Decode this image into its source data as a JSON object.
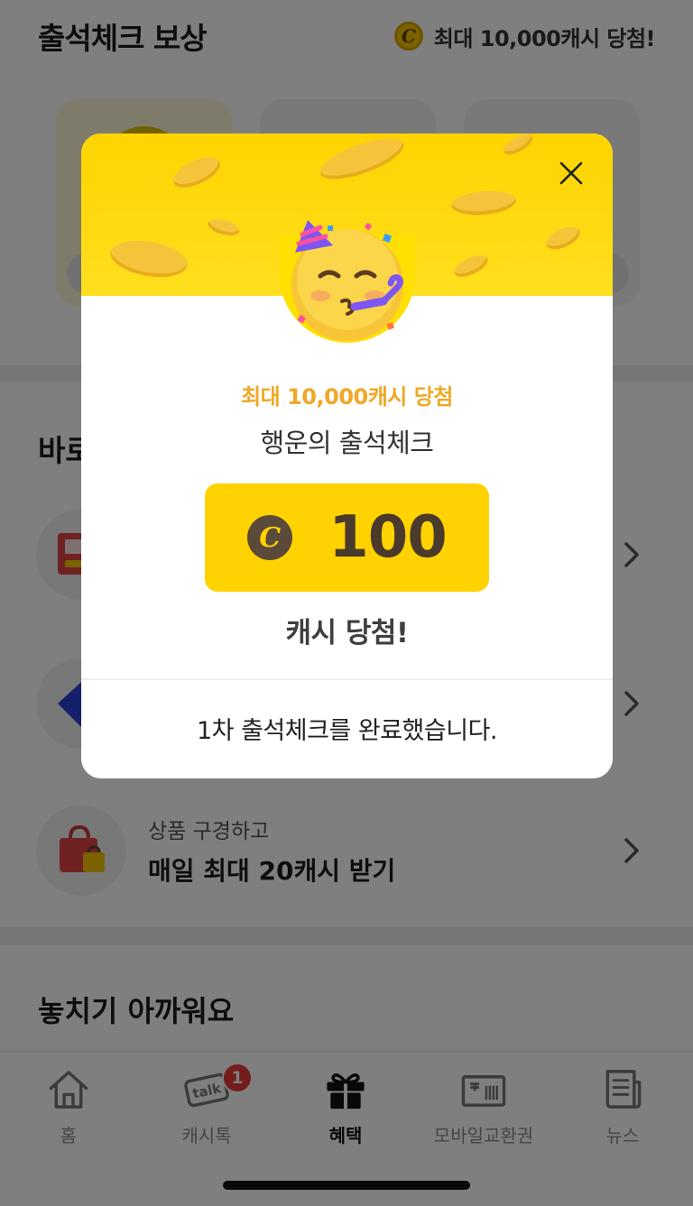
{
  "header": {
    "title": "출석체크 보상",
    "promo_text": "최대 10,000캐시 당첨!",
    "coin_symbol": "C"
  },
  "sections": {
    "shortcuts_title": "바로",
    "missed_title": "놓치기 아까워요"
  },
  "shortcuts": [
    {
      "icon": "receipt-icon",
      "sub": "",
      "main": ""
    },
    {
      "icon": "diamond-icon",
      "sub": "",
      "main": ""
    },
    {
      "icon": "shopping-bag-icon",
      "sub": "상품 구경하고",
      "main": "매일 최대 20캐시 받기"
    }
  ],
  "tabbar": {
    "items": [
      {
        "label": "홈",
        "icon": "home-icon"
      },
      {
        "label": "캐시톡",
        "icon": "talk-icon",
        "badge": "1"
      },
      {
        "label": "혜택",
        "icon": "gift-icon",
        "active": true
      },
      {
        "label": "모바일교환권",
        "icon": "ticket-icon"
      },
      {
        "label": "뉴스",
        "icon": "news-icon"
      }
    ]
  },
  "modal": {
    "promo": "최대 10,000캐시 당첨",
    "subtitle": "행운의 출석체크",
    "coin_symbol": "C",
    "amount": "100",
    "result": "캐시 당첨!",
    "footer": "1차 출석체크를 완료했습니다."
  },
  "colors": {
    "accent_yellow": "#ffd200",
    "promo_orange": "#f0a826",
    "badge_red": "#e83a3a"
  }
}
